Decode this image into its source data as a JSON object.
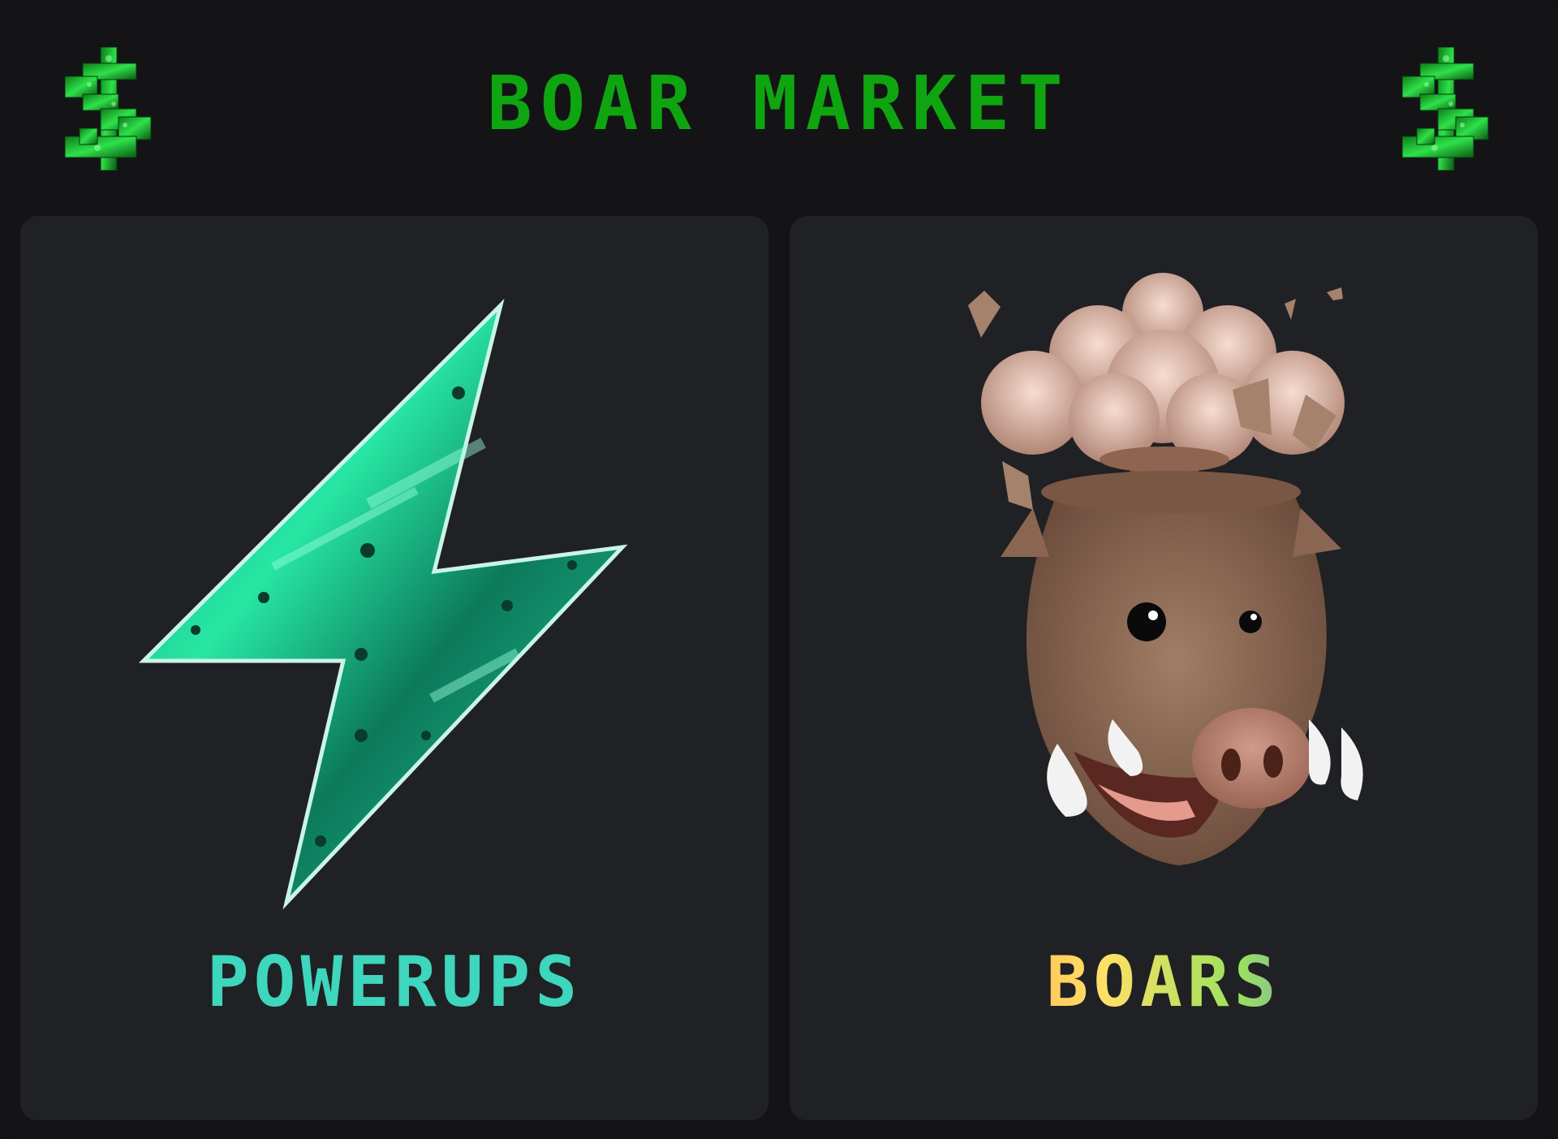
{
  "header": {
    "title": "BOAR MARKET",
    "left_icon": "dollar-sign-icon",
    "right_icon": "dollar-sign-icon"
  },
  "cards": [
    {
      "label": "POWERUPS",
      "icon": "lightning-bolt-icon",
      "label_color": "#3ed6bd"
    },
    {
      "label": "BOARS",
      "icon": "boar-head-icon",
      "label_colors": [
        "#ff6b6b",
        "#ffa94d",
        "#ffe066",
        "#9be15d",
        "#5c7cfa",
        "#9c5cf6"
      ]
    }
  ],
  "colors": {
    "background": "#141417",
    "card": "#202124",
    "title": "#0ea510"
  }
}
